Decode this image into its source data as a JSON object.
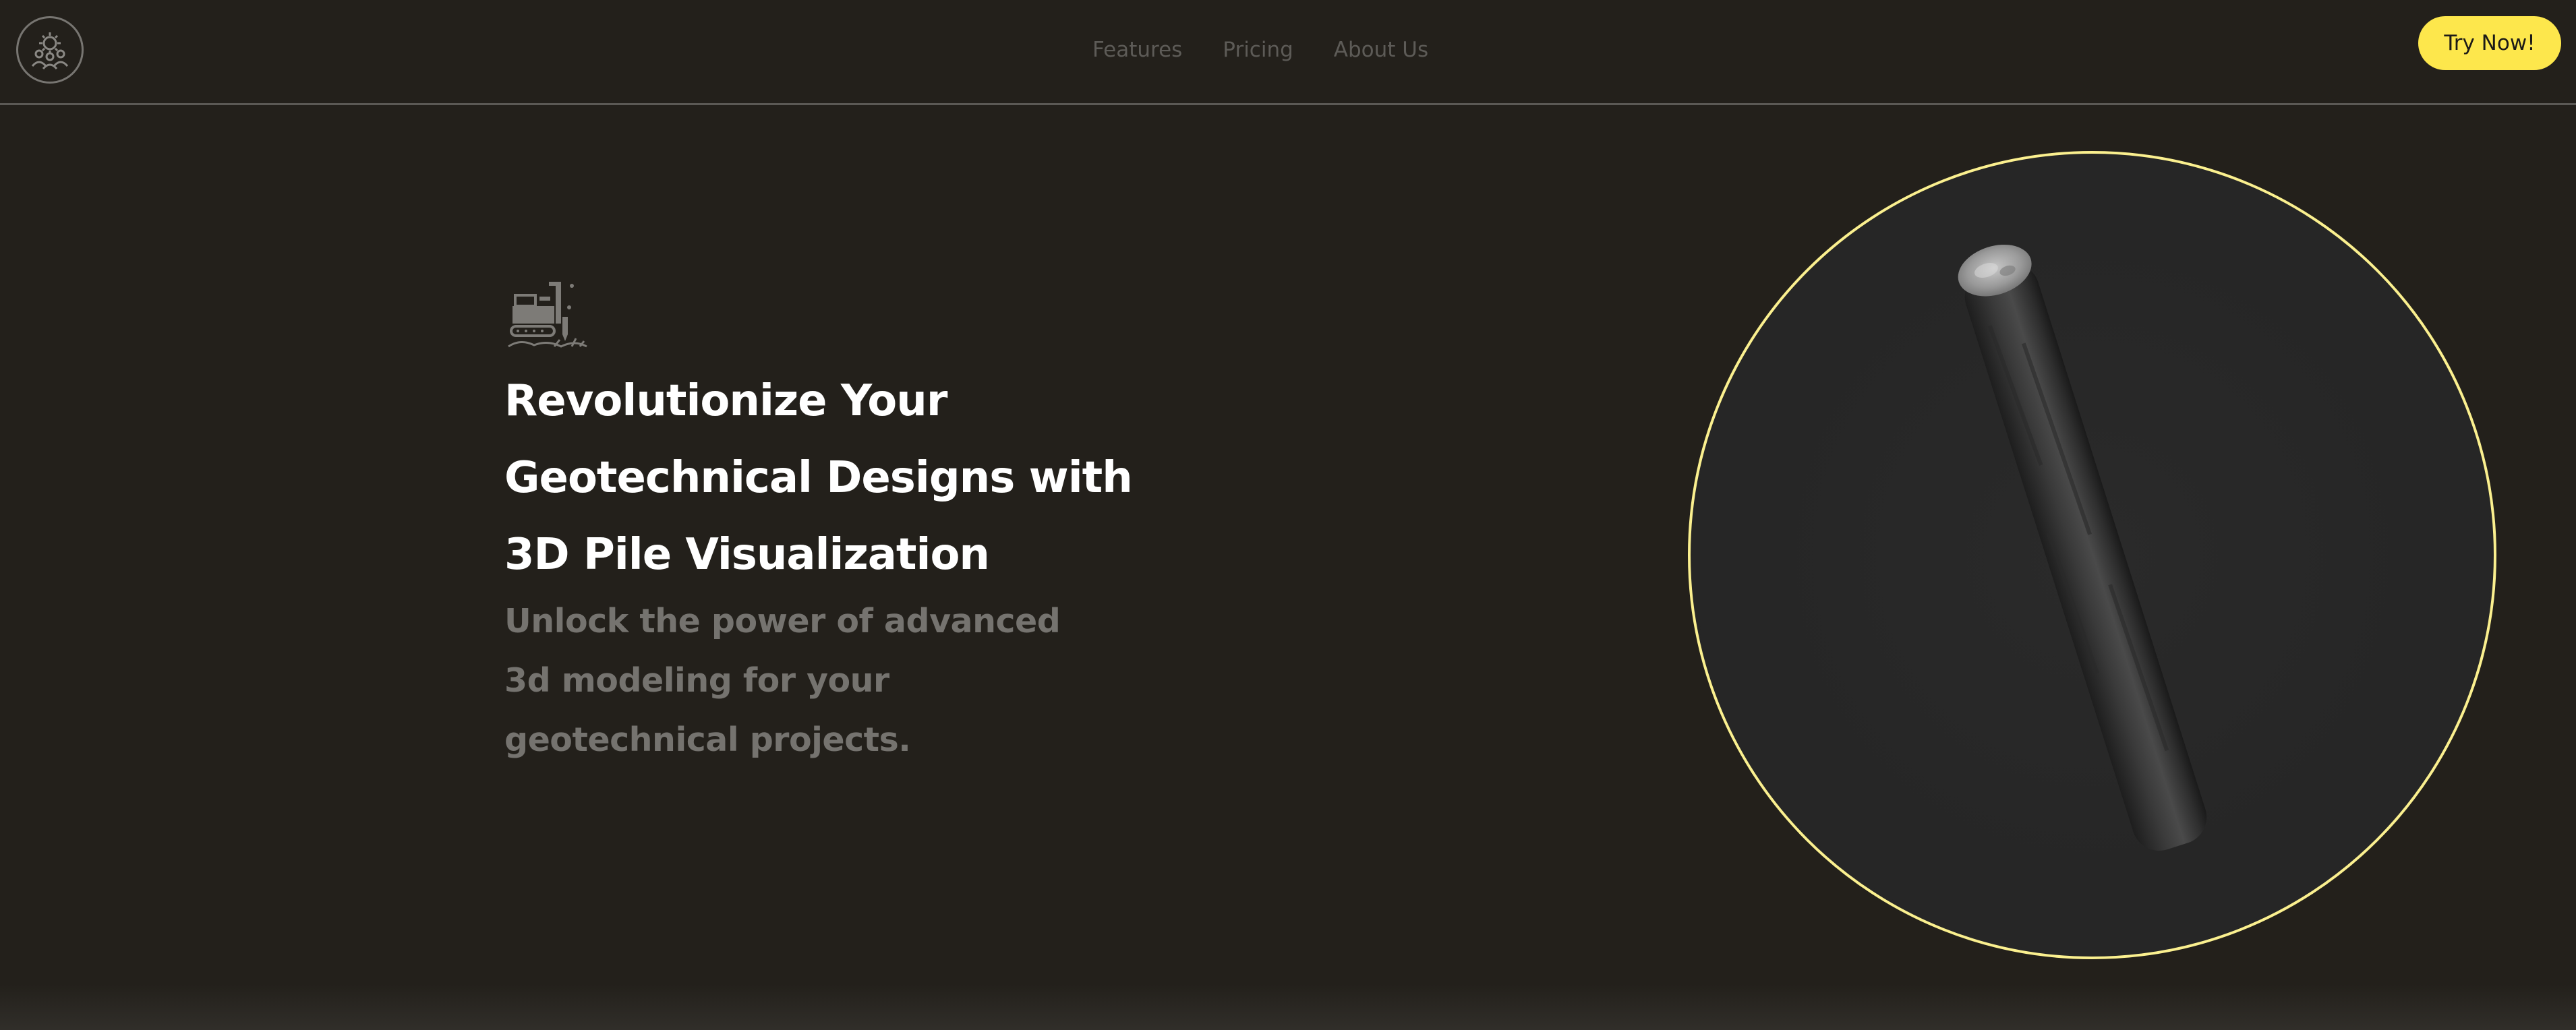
{
  "header": {
    "logo_icon": "gear-people-icon",
    "nav": [
      {
        "label": "Features"
      },
      {
        "label": "Pricing"
      },
      {
        "label": "About Us"
      }
    ],
    "cta_label": "Try Now!"
  },
  "hero": {
    "icon": "excavator-drill-icon",
    "title": "Revolutionize Your Geotechnical Designs with 3D Pile Visualization",
    "subtitle": "Unlock the power of advanced 3d modeling for your geotechnical projects."
  },
  "viewer": {
    "model": "3d-pile-cylinder"
  },
  "colors": {
    "background": "#23201b",
    "accent": "#fde74c",
    "ring": "#fbf08f",
    "title": "#ffffff",
    "subtitle": "#75736f",
    "nav": "#5d5b57"
  }
}
